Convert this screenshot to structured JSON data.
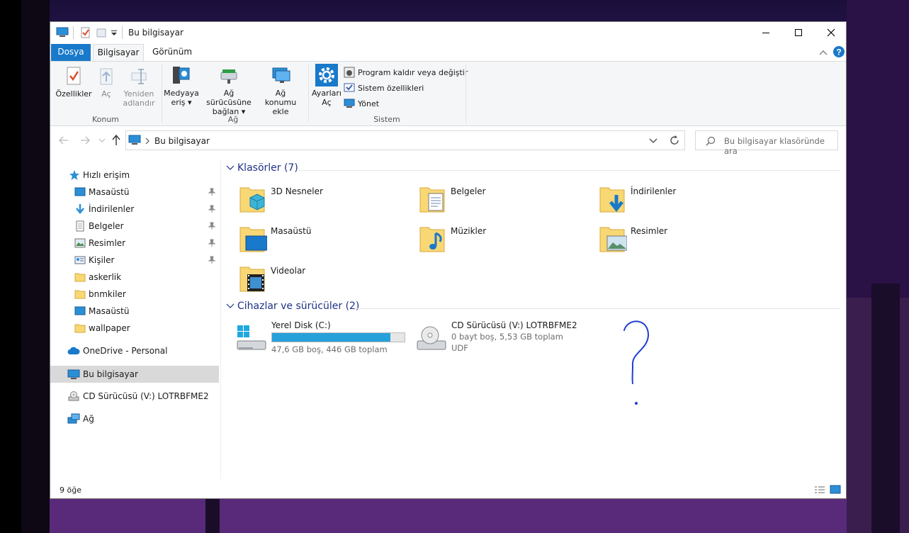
{
  "window": {
    "title": "Bu bilgisayar"
  },
  "tabs": [
    {
      "label": "Dosya"
    },
    {
      "label": "Bilgisayar"
    },
    {
      "label": "Görünüm"
    }
  ],
  "ribbon": {
    "konum": {
      "label": "Konum",
      "properties": "Özellikler",
      "open": "Aç",
      "rename_1": "Yeniden",
      "rename_2": "adlandır"
    },
    "ag": {
      "label": "Ağ",
      "media_1": "Medyaya",
      "media_2": "eriş",
      "map_1": "Ağ sürücüsüne",
      "map_2": "bağlan",
      "add_1": "Ağ konumu",
      "add_2": "ekle"
    },
    "sistem": {
      "label": "Sistem",
      "settings_1": "Ayarları",
      "settings_2": "Aç",
      "uninstall": "Program kaldır veya değiştir",
      "sysprops": "Sistem özellikleri",
      "manage": "Yönet"
    }
  },
  "address": {
    "path": "Bu bilgisayar",
    "search_placeholder": "Bu bilgisayar klasöründe ara"
  },
  "sidebar": {
    "quick_access": "Hızlı erişim",
    "quick_items": [
      {
        "label": "Masaüstü"
      },
      {
        "label": "İndirilenler"
      },
      {
        "label": "Belgeler"
      },
      {
        "label": "Resimler"
      },
      {
        "label": "Kişiler"
      },
      {
        "label": "askerlik"
      },
      {
        "label": "bnmkiler"
      },
      {
        "label": "Masaüstü"
      },
      {
        "label": "wallpaper"
      }
    ],
    "onedrive": "OneDrive - Personal",
    "this_pc": "Bu bilgisayar",
    "cd_drive": "CD Sürücüsü (V:) LOTRBFME2",
    "network": "Ağ"
  },
  "content": {
    "folders_header": "Klasörler (7)",
    "folders": [
      {
        "label": "3D Nesneler"
      },
      {
        "label": "Belgeler"
      },
      {
        "label": "İndirilenler"
      },
      {
        "label": "Masaüstü"
      },
      {
        "label": "Müzikler"
      },
      {
        "label": "Resimler"
      },
      {
        "label": "Videolar"
      }
    ],
    "drives_header": "Cihazlar ve sürücüler (2)",
    "drives": [
      {
        "name": "Yerel Disk (C:)",
        "info": "47,6 GB boş, 446 GB toplam",
        "used_fraction": 0.893
      },
      {
        "name": "CD Sürücüsü (V:) LOTRBFME2",
        "info": "0 bayt boş, 5,53 GB toplam",
        "fs": "UDF"
      }
    ]
  },
  "status": {
    "count": "9 öğe"
  },
  "colors": {
    "accent": "#1979ca",
    "header_text": "#1e3287",
    "selection": "#d9d9d9",
    "progress": "#26a0da"
  }
}
